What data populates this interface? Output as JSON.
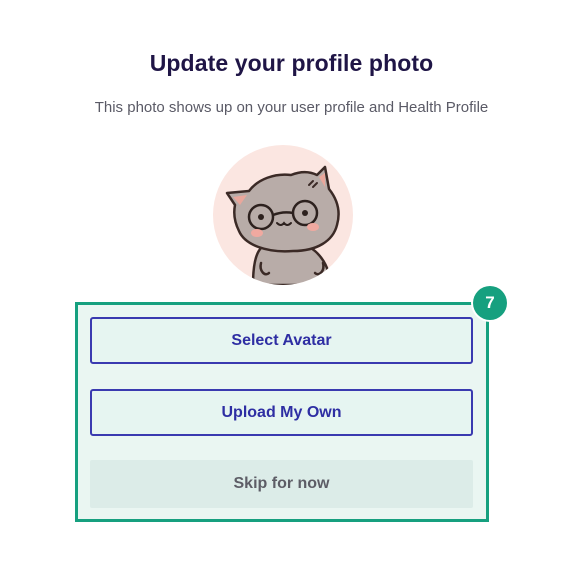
{
  "header": {
    "title": "Update your profile photo",
    "subtitle": "This photo shows up on your user profile and Health Profile"
  },
  "avatar": {
    "icon": "cat-with-glasses-avatar"
  },
  "actions": {
    "select_avatar_label": "Select Avatar",
    "upload_label": "Upload My Own",
    "skip_label": "Skip for now"
  },
  "annotation": {
    "badge_number": "7",
    "color": "#16a07f"
  },
  "colors": {
    "title": "#1f1546",
    "button_border": "#3a3ab0",
    "button_text": "#2e2ea3",
    "avatar_background": "#fbe6e1"
  }
}
